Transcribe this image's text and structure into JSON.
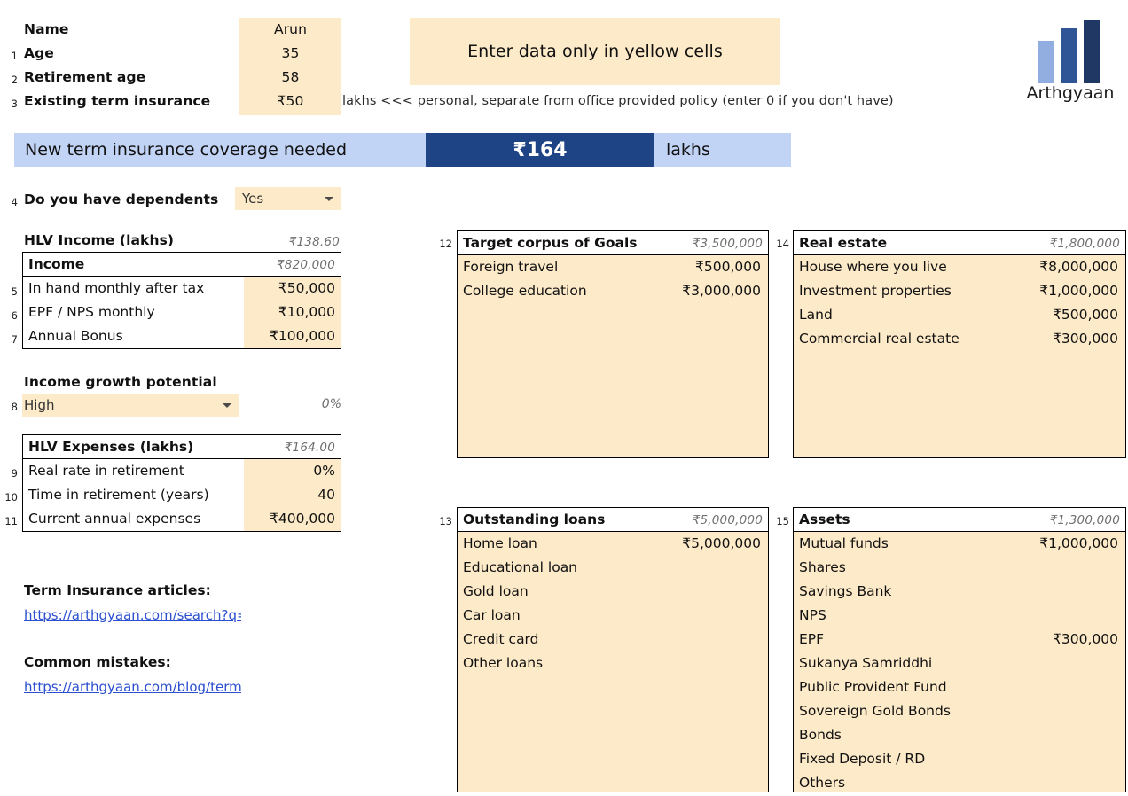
{
  "profile": {
    "name_label": "Name",
    "name_value": "Arun",
    "rows": [
      {
        "num": "1",
        "label": "Age",
        "value": "35"
      },
      {
        "num": "2",
        "label": "Retirement age",
        "value": "58"
      },
      {
        "num": "3",
        "label": "Existing term insurance",
        "value": "₹50"
      }
    ],
    "insurance_note": "lakhs <<< personal, separate from office provided policy (enter 0 if you don't have)"
  },
  "notice": {
    "text": "Enter data only in yellow cells"
  },
  "logo": {
    "wordmark": "Arthgyaan",
    "bar_colors": [
      "#92aee0",
      "#2f5596",
      "#1f3864"
    ]
  },
  "banner": {
    "title": "New term insurance coverage needed",
    "amount": "₹164",
    "unit": "lakhs",
    "bg_color": "#c2d4f5",
    "amount_bg_color": "#1f4486"
  },
  "dependents": {
    "num": "4",
    "label": "Do you have dependents",
    "value": "Yes"
  },
  "hlv_income": {
    "title": "HLV Income (lakhs)",
    "total": "₹138.60",
    "subheader_label": "Income",
    "subheader_value": "₹820,000",
    "rows": [
      {
        "num": "5",
        "label": "In hand monthly after tax",
        "value": "₹50,000"
      },
      {
        "num": "6",
        "label": "EPF / NPS monthly",
        "value": "₹10,000"
      },
      {
        "num": "7",
        "label": "Annual Bonus",
        "value": "₹100,000"
      }
    ]
  },
  "income_growth": {
    "label": "Income growth potential",
    "num": "8",
    "value": "High",
    "percent": "0%"
  },
  "hlv_expenses": {
    "title": "HLV Expenses (lakhs)",
    "total": "₹164.00",
    "rows": [
      {
        "num": "9",
        "label": "Real rate in retirement",
        "value": "0%"
      },
      {
        "num": "10",
        "label": "Time in retirement (years)",
        "value": "40"
      },
      {
        "num": "11",
        "label": "Current annual expenses",
        "value": "₹400,000"
      }
    ]
  },
  "links": {
    "articles_label": "Term Insurance articles:",
    "articles_url": "https://arthgyaan.com/search?q=term+insurance",
    "mistakes_label": "Common mistakes:",
    "mistakes_url": "https://arthgyaan.com/blog/term-insurance-mistakes"
  },
  "goals": {
    "num": "12",
    "title": "Target corpus of Goals",
    "total": "₹3,500,000",
    "rows": [
      {
        "label": "Foreign travel",
        "value": "₹500,000"
      },
      {
        "label": "College education",
        "value": "₹3,000,000"
      }
    ]
  },
  "real_estate": {
    "num": "14",
    "title": "Real estate",
    "total": "₹1,800,000",
    "rows": [
      {
        "label": "House where you live",
        "value": "₹8,000,000"
      },
      {
        "label": "Investment properties",
        "value": "₹1,000,000"
      },
      {
        "label": "Land",
        "value": "₹500,000"
      },
      {
        "label": "Commercial real estate",
        "value": "₹300,000"
      }
    ]
  },
  "loans": {
    "num": "13",
    "title": "Outstanding loans",
    "total": "₹5,000,000",
    "rows": [
      {
        "label": "Home loan",
        "value": "₹5,000,000"
      },
      {
        "label": "Educational loan",
        "value": ""
      },
      {
        "label": "Gold loan",
        "value": ""
      },
      {
        "label": "Car loan",
        "value": ""
      },
      {
        "label": "Credit card",
        "value": ""
      },
      {
        "label": "Other loans",
        "value": ""
      }
    ]
  },
  "assets": {
    "num": "15",
    "title": "Assets",
    "total": "₹1,300,000",
    "rows": [
      {
        "label": "Mutual funds",
        "value": "₹1,000,000"
      },
      {
        "label": "Shares",
        "value": ""
      },
      {
        "label": "Savings Bank",
        "value": ""
      },
      {
        "label": "NPS",
        "value": ""
      },
      {
        "label": "EPF",
        "value": "₹300,000"
      },
      {
        "label": "Sukanya Samriddhi",
        "value": ""
      },
      {
        "label": "Public Provident Fund",
        "value": ""
      },
      {
        "label": "Sovereign Gold Bonds",
        "value": ""
      },
      {
        "label": "Bonds",
        "value": ""
      },
      {
        "label": "Fixed Deposit / RD",
        "value": ""
      },
      {
        "label": "Others",
        "value": ""
      }
    ]
  },
  "colors": {
    "input_yellow": "#fdeac8",
    "accent_blue": "#1f4486",
    "light_blue": "#c2d4f5",
    "link_blue": "#2b4fcf"
  }
}
